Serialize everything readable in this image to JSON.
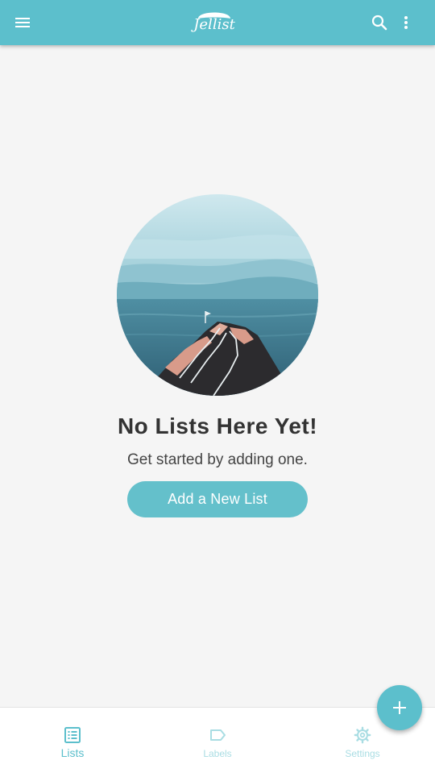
{
  "app_bar": {
    "logo_text": "Jellist",
    "icons": {
      "menu": "menu-icon",
      "search": "search-icon",
      "more": "more-vertical-icon"
    }
  },
  "empty_state": {
    "title": "No Lists Here Yet!",
    "subtitle": "Get started by adding one.",
    "button_label": "Add a New List",
    "illustration": "mountain-lookout-illustration"
  },
  "bottom_nav": {
    "items": [
      {
        "label": "Lists",
        "icon": "list-icon",
        "active": true
      },
      {
        "label": "Labels",
        "icon": "label-tag-icon",
        "active": false
      },
      {
        "label": "Settings",
        "icon": "gear-icon",
        "active": false
      }
    ]
  },
  "fab": {
    "icon": "plus-icon"
  },
  "colors": {
    "primary": "#5cbfcc",
    "primary_light": "#a9dde3",
    "background": "#f5f5f5",
    "text_dark": "#333333"
  }
}
